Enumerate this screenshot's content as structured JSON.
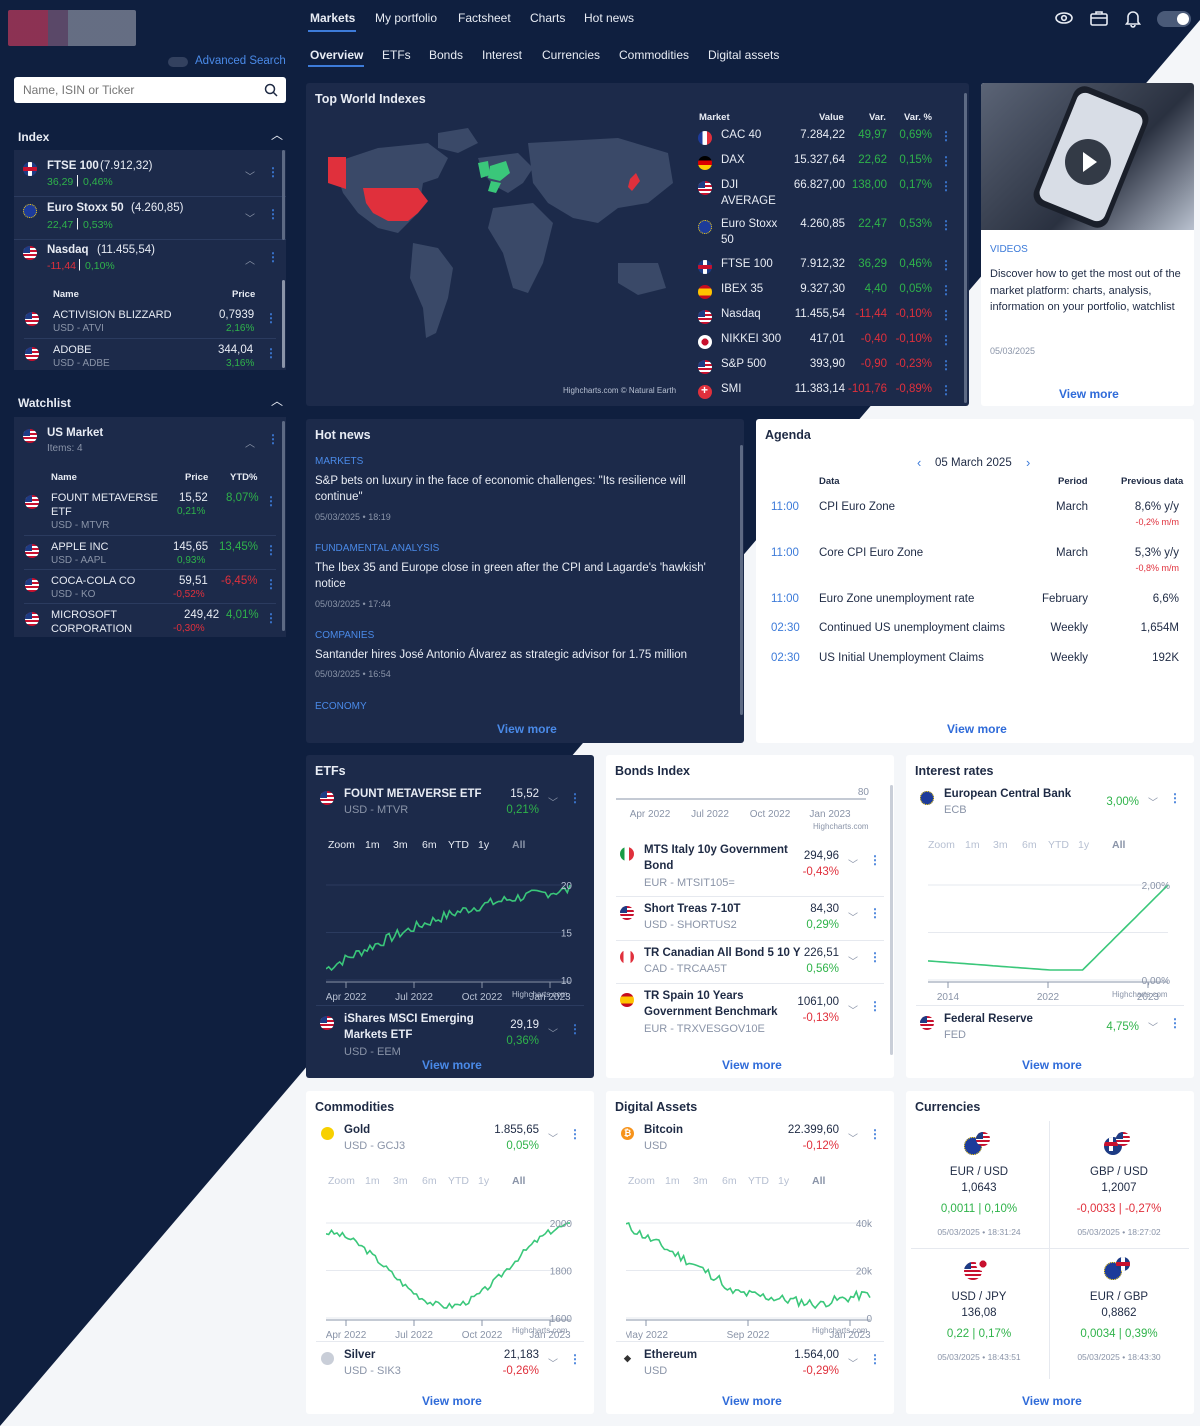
{
  "topnav": {
    "items": [
      "Markets",
      "My portfolio",
      "Factsheet",
      "Charts",
      "Hot news"
    ]
  },
  "subnav": {
    "items": [
      "Overview",
      "ETFs",
      "Bonds",
      "Interest",
      "Currencies",
      "Commodities",
      "Digital assets"
    ]
  },
  "sidebar": {
    "advanced_search": "Advanced Search",
    "search_placeholder": "Name, ISIN or Ticker",
    "index_title": "Index",
    "indexes": [
      {
        "name": "FTSE 100",
        "value": "(7.912,32)",
        "chg": "36,29",
        "pct": "0,46%"
      },
      {
        "name": "Euro Stoxx 50",
        "value": "(4.260,85)",
        "chg": "22,47",
        "pct": "0,53%"
      },
      {
        "name": "Nasdaq",
        "value": "(11.455,54)",
        "chg": "-11,44",
        "pct": "0,10%"
      }
    ],
    "nasdaq_cols": {
      "name": "Name",
      "price": "Price"
    },
    "nasdaq_items": [
      {
        "name": "ACTIVISION BLIZZARD",
        "sub": "USD - ATVI",
        "price": "0,7939",
        "chg": "2,16%"
      },
      {
        "name": "ADOBE",
        "sub": "USD - ADBE",
        "price": "344,04",
        "chg": "3,16%"
      }
    ],
    "watchlist_title": "Watchlist",
    "watchlist_name": "US Market",
    "watchlist_items_count": "Items: 4",
    "wl_cols": {
      "name": "Name",
      "price": "Price",
      "ytd": "YTD%"
    },
    "wl_items": [
      {
        "name": "FOUNT METAVERSE",
        "name2": "ETF",
        "sub": "USD - MTVR",
        "price": "15,52",
        "chg": "0,21%",
        "ytd": "8,07%"
      },
      {
        "name": "APPLE INC",
        "name2": "",
        "sub": "USD - AAPL",
        "price": "145,65",
        "chg": "0,93%",
        "ytd": "13,45%"
      },
      {
        "name": "COCA-COLA CO",
        "name2": "",
        "sub": "USD - KO",
        "price": "59,51",
        "chg": "-0,52%",
        "ytd": "-6,45%"
      },
      {
        "name": "MICROSOFT",
        "name2": "CORPORATION",
        "sub": "",
        "price": "249,42",
        "chg": "-0,30%",
        "ytd": "4,01%"
      }
    ]
  },
  "world": {
    "title": "Top World Indexes",
    "cols": {
      "market": "Market",
      "value": "Value",
      "var": "Var.",
      "varp": "Var. %"
    },
    "rows": [
      {
        "name": "CAC 40",
        "name2": "",
        "value": "7.284,22",
        "var": "49,97",
        "varp": "0,69%",
        "flag": "fr",
        "up": true
      },
      {
        "name": "DAX",
        "name2": "",
        "value": "15.327,64",
        "var": "22,62",
        "varp": "0,15%",
        "flag": "de",
        "up": true
      },
      {
        "name": "DJI",
        "name2": "AVERAGE",
        "value": "66.827,00",
        "var": "138,00",
        "varp": "0,17%",
        "flag": "us",
        "up": true
      },
      {
        "name": "Euro Stoxx",
        "name2": "50",
        "value": "4.260,85",
        "var": "22,47",
        "varp": "0,53%",
        "flag": "eu",
        "up": true
      },
      {
        "name": "FTSE 100",
        "name2": "",
        "value": "7.912,32",
        "var": "36,29",
        "varp": "0,46%",
        "flag": "uk",
        "up": true
      },
      {
        "name": "IBEX 35",
        "name2": "",
        "value": "9.327,30",
        "var": "4,40",
        "varp": "0,05%",
        "flag": "es",
        "up": true
      },
      {
        "name": "Nasdaq",
        "name2": "",
        "value": "11.455,54",
        "var": "-11,44",
        "varp": "-0,10%",
        "flag": "us",
        "up": false
      },
      {
        "name": "NIKKEI 300",
        "name2": "",
        "value": "417,01",
        "var": "-0,40",
        "varp": "-0,10%",
        "flag": "jp",
        "up": false
      },
      {
        "name": "S&P 500",
        "name2": "",
        "value": "393,90",
        "var": "-0,90",
        "varp": "-0,23%",
        "flag": "us",
        "up": false
      },
      {
        "name": "SMI",
        "name2": "",
        "value": "11.383,14",
        "var": "-101,76",
        "varp": "-0,89%",
        "flag": "ch",
        "up": false
      }
    ],
    "credit": "Highcharts.com © Natural Earth"
  },
  "video": {
    "tag": "VIDEOS",
    "text": "Discover how to get the most out of the market platform: charts, analysis, information on your portfolio, watchlist",
    "date": "05/03/2025",
    "more": "View more"
  },
  "hotnews": {
    "title": "Hot news",
    "items": [
      {
        "cat": "MARKETS",
        "text": "S&P bets on luxury in the face of economic challenges: \"Its resilience will",
        "text2": "continue\"",
        "date": "05/03/2025 • 18:19"
      },
      {
        "cat": "FUNDAMENTAL ANALYSIS",
        "text": "The Ibex 35 and Europe close in green after the CPI and Lagarde's 'hawkish'",
        "text2": "notice",
        "date": "05/03/2025 • 17:44"
      },
      {
        "cat": "COMPANIES",
        "text": "Santander hires José Antonio Álvarez as strategic advisor for 1.75 million",
        "text2": "",
        "date": "05/03/2025 • 16:54"
      },
      {
        "cat": "ECONOMY",
        "text": "",
        "text2": "",
        "date": ""
      }
    ],
    "more": "View more"
  },
  "agenda": {
    "title": "Agenda",
    "date": "05 March 2025",
    "cols": {
      "data": "Data",
      "period": "Period",
      "prev": "Previous data"
    },
    "rows": [
      {
        "time": "11:00",
        "name": "CPI Euro Zone",
        "period": "March",
        "prev": "8,6% y/y",
        "sub": "-0,2% m/m"
      },
      {
        "time": "11:00",
        "name": "Core CPI Euro Zone",
        "period": "March",
        "prev": "5,3% y/y",
        "sub": "-0,8% m/m"
      },
      {
        "time": "11:00",
        "name": "Euro Zone unemployment rate",
        "period": "February",
        "prev": "6,6%",
        "sub": ""
      },
      {
        "time": "02:30",
        "name": "Continued US unemployment claims",
        "period": "Weekly",
        "prev": "1,654M",
        "sub": ""
      },
      {
        "time": "02:30",
        "name": "US Initial Unemployment Claims",
        "period": "Weekly",
        "prev": "192K",
        "sub": ""
      }
    ],
    "more": "View more"
  },
  "zoom": {
    "label": "Zoom",
    "opts": [
      "1m",
      "3m",
      "6m",
      "YTD",
      "1y",
      "All"
    ]
  },
  "etfs": {
    "title": "ETFs",
    "top": {
      "name": "FOUNT METAVERSE ETF",
      "sub": "USD - MTVR",
      "price": "15,52",
      "chg": "0,21%"
    },
    "bottom": {
      "name": "iShares MSCI Emerging",
      "name2": "Markets ETF",
      "sub": "USD - EEM",
      "price": "29,19",
      "chg": "0,36%"
    },
    "xticks": [
      "Apr 2022",
      "Jul 2022",
      "Oct 2022",
      "Jan 2023"
    ],
    "yticks": [
      "20",
      "15",
      "10"
    ],
    "credit": "Highcharts.com",
    "more": "View more"
  },
  "bonds": {
    "title": "Bonds Index",
    "xticks": [
      "Apr 2022",
      "Jul 2022",
      "Oct 2022",
      "Jan 2023"
    ],
    "ytick": "80",
    "credit": "Highcharts.com",
    "items": [
      {
        "name": "MTS Italy 10y Government",
        "name2": "Bond",
        "sub": "EUR - MTSIT105=",
        "price": "294,96",
        "chg": "-0,43%",
        "flag": "it"
      },
      {
        "name": "Short Treas 7-10T",
        "name2": "",
        "sub": "USD - SHORTUS2",
        "price": "84,30",
        "chg": "0,29%",
        "flag": "us"
      },
      {
        "name": "TR Canadian All Bond 5 10 Y",
        "name2": "",
        "sub": "CAD - TRCAA5T",
        "price": "226,51",
        "chg": "0,56%",
        "flag": "ca"
      },
      {
        "name": "TR Spain 10 Years",
        "name2": "Government Benchmark",
        "sub": "EUR - TRXVESGOV10E",
        "price": "1061,00",
        "chg": "-0,13%",
        "flag": "es"
      }
    ],
    "more": "View more"
  },
  "interest": {
    "title": "Interest rates",
    "top": {
      "name": "European Central Bank",
      "sub": "ECB",
      "rate": "3,00%"
    },
    "bottom": {
      "name": "Federal Reserve",
      "sub": "FED",
      "rate": "4,75%"
    },
    "xticks": [
      "2014",
      "2022",
      "2023"
    ],
    "yticks": [
      "2,00%",
      "0,00%"
    ],
    "credit": "Highcharts.com",
    "more": "View more"
  },
  "commodities": {
    "title": "Commodities",
    "top": {
      "name": "Gold",
      "sub": "USD - GCJ3",
      "price": "1.855,65",
      "chg": "0,05%"
    },
    "bottom": {
      "name": "Silver",
      "sub": "USD - SIK3",
      "price": "21,183",
      "chg": "-0,26%"
    },
    "xticks": [
      "Apr 2022",
      "Jul 2022",
      "Oct 2022",
      "Jan 2023"
    ],
    "yticks": [
      "2000",
      "1800",
      "1600"
    ],
    "credit": "Highcharts.com",
    "more": "View more"
  },
  "digital": {
    "title": "Digital Assets",
    "top": {
      "name": "Bitcoin",
      "sub": "USD",
      "price": "22.399,60",
      "chg": "-0,12%"
    },
    "bottom": {
      "name": "Ethereum",
      "sub": "USD",
      "price": "1.564,00",
      "chg": "-0,29%"
    },
    "xticks": [
      "May 2022",
      "Sep 2022",
      "Jan 2023"
    ],
    "yticks": [
      "40k",
      "20k",
      "0"
    ],
    "credit": "Highcharts.com",
    "more": "View more"
  },
  "currencies": {
    "title": "Currencies",
    "items": [
      {
        "pair": "EUR / USD",
        "value": "1,0643",
        "chg": "0,0011 | 0,10%",
        "date": "05/03/2025 • 18:31:24",
        "up": true
      },
      {
        "pair": "GBP / USD",
        "value": "1,2007",
        "chg": "-0,0033 | -0,27%",
        "date": "05/03/2025 • 18:27:02",
        "up": false
      },
      {
        "pair": "USD / JPY",
        "value": "136,08",
        "chg": "0,22 | 0,17%",
        "date": "05/03/2025 • 18:43:51",
        "up": true
      },
      {
        "pair": "EUR / GBP",
        "value": "0,8862",
        "chg": "0,0034 | 0,39%",
        "date": "05/03/2025 • 18:43:30",
        "up": true
      }
    ],
    "more": "View more"
  }
}
